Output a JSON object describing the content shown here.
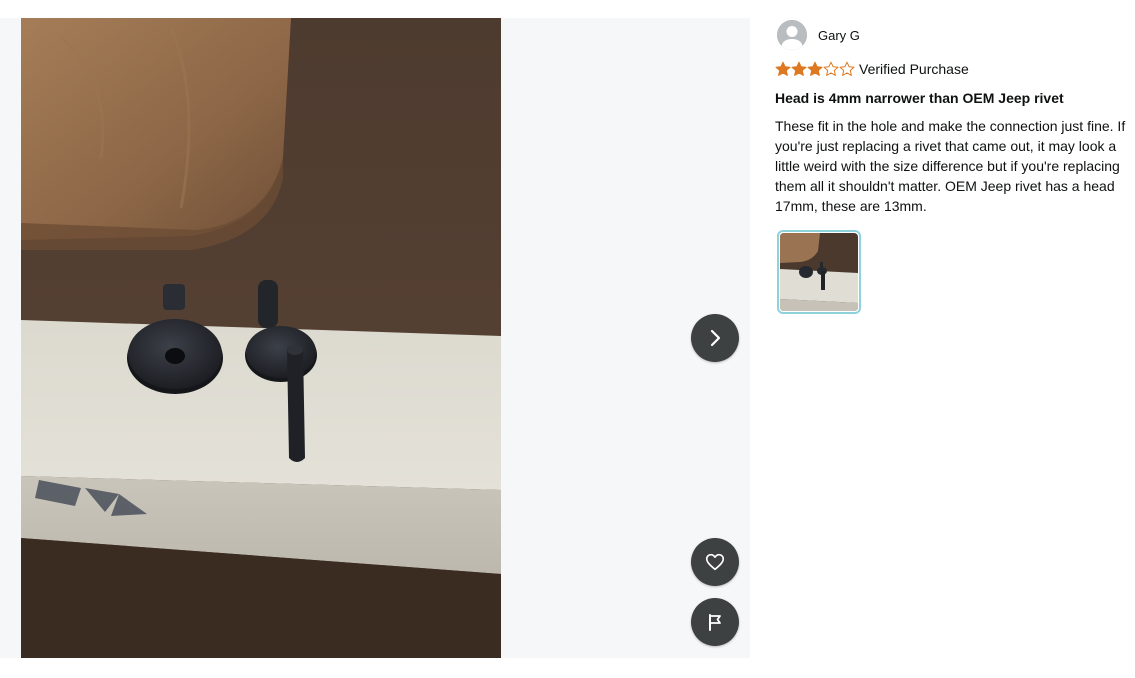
{
  "viewer": {
    "next_label": "Next image",
    "like_label": "Helpful",
    "report_label": "Report"
  },
  "reviewer": {
    "name": "Gary G",
    "avatar_icon": "default-user-avatar"
  },
  "review": {
    "rating": 3,
    "rating_max": 5,
    "star_color": "#de7921",
    "verified_text": "Verified Purchase",
    "title": "Head is 4mm narrower than OEM Jeep rivet",
    "body": "These fit in the hole and make the connection just fine. If you're just replacing a rivet that came out, it may look a little weird with the size difference but if you're replacing them all it shouldn't matter. OEM Jeep rivet has a head 17mm, these are 13mm."
  },
  "thumbnails": [
    {
      "selected": true,
      "border_color": "#8ed3dc"
    }
  ],
  "icons": {
    "next": "chevron-right-icon",
    "like": "heart-icon",
    "report": "flag-icon"
  }
}
